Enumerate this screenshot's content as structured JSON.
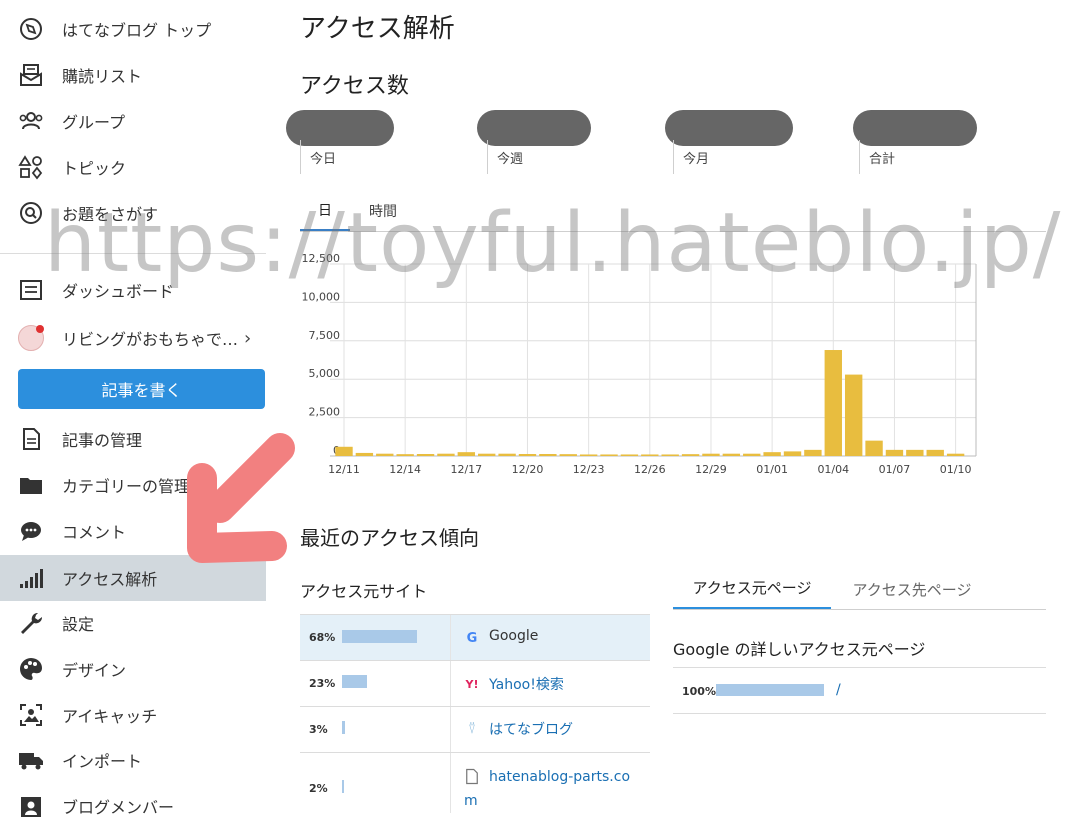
{
  "sidebar": {
    "items": [
      {
        "label": "はてなブログ トップ",
        "icon": "compass-icon"
      },
      {
        "label": "購読リスト",
        "icon": "reader-icon"
      },
      {
        "label": "グループ",
        "icon": "group-icon"
      },
      {
        "label": "トピック",
        "icon": "topic-shapes-icon"
      },
      {
        "label": "お題をさがす",
        "icon": "search-theme-icon"
      },
      {
        "label": "ダッシュボード",
        "icon": "dashboard-icon"
      },
      {
        "label": "リビングがおもちゃで…",
        "icon": "blog-avatar"
      },
      {
        "label": "記事の管理",
        "icon": "document-icon"
      },
      {
        "label": "カテゴリーの管理",
        "icon": "folder-icon"
      },
      {
        "label": "コメント",
        "icon": "comment-icon"
      },
      {
        "label": "アクセス解析",
        "icon": "signal-bars-icon"
      },
      {
        "label": "設定",
        "icon": "wrench-icon"
      },
      {
        "label": "デザイン",
        "icon": "palette-icon"
      },
      {
        "label": "アイキャッチ",
        "icon": "image-icon"
      },
      {
        "label": "インポート",
        "icon": "truck-icon"
      },
      {
        "label": "ブログメンバー",
        "icon": "member-icon"
      }
    ],
    "write_button": "記事を書く",
    "blog_chevron": "›",
    "active_item": "アクセス解析"
  },
  "main": {
    "title": "アクセス解析",
    "access_title": "アクセス数",
    "stats": [
      "今日",
      "今週",
      "今月",
      "合計"
    ],
    "tabs": [
      "日",
      "時間"
    ],
    "trend_title": "最近のアクセス傾向",
    "sources_title": "アクセス元サイト",
    "sources": [
      {
        "pct": "68%",
        "share": 0.68,
        "name": "Google",
        "icon": "G"
      },
      {
        "pct": "23%",
        "share": 0.23,
        "name": "Yahoo!検索",
        "icon": "Y!"
      },
      {
        "pct": "3%",
        "share": 0.03,
        "name": "はてなブログ",
        "icon": "⍢"
      },
      {
        "pct": "2%",
        "share": 0.02,
        "name": "hatenablog-parts.com",
        "icon": "doc"
      }
    ],
    "page_tabs": [
      "アクセス元ページ",
      "アクセス先ページ"
    ],
    "google_detail_title": "Google の詳しいアクセス元ページ",
    "google_detail": {
      "pct": "100%",
      "share": 1.0,
      "path": "/"
    }
  },
  "watermark": "https://toyful.hateblo.jp/",
  "colors": {
    "accent": "#2c8fdd",
    "bar": "#e8bd3f",
    "source_bar": "#a9c9e8",
    "active_bg": "#d1d8dd",
    "arrow": "#f28080"
  },
  "chart_data": {
    "type": "bar",
    "categories": [
      "12/11",
      "12/12",
      "12/13",
      "12/14",
      "12/15",
      "12/16",
      "12/17",
      "12/18",
      "12/19",
      "12/20",
      "12/21",
      "12/22",
      "12/23",
      "12/24",
      "12/25",
      "12/26",
      "12/27",
      "12/28",
      "12/29",
      "12/30",
      "12/31",
      "01/01",
      "01/02",
      "01/03",
      "01/04",
      "01/05",
      "01/06",
      "01/07",
      "01/08",
      "01/09",
      "01/10"
    ],
    "tick_labels": [
      "12/11",
      "12/14",
      "12/17",
      "12/20",
      "12/23",
      "12/26",
      "12/29",
      "01/01",
      "01/04",
      "01/07",
      "01/10"
    ],
    "values": [
      600,
      200,
      150,
      120,
      130,
      150,
      250,
      150,
      150,
      130,
      130,
      120,
      100,
      100,
      100,
      100,
      100,
      120,
      150,
      150,
      150,
      250,
      300,
      400,
      6900,
      5300,
      1000,
      400,
      400,
      400,
      150
    ],
    "yticks": [
      "0",
      "2,500",
      "5,000",
      "7,500",
      "10,000",
      "12,500"
    ],
    "ylim": [
      0,
      12500
    ],
    "grid": true
  }
}
